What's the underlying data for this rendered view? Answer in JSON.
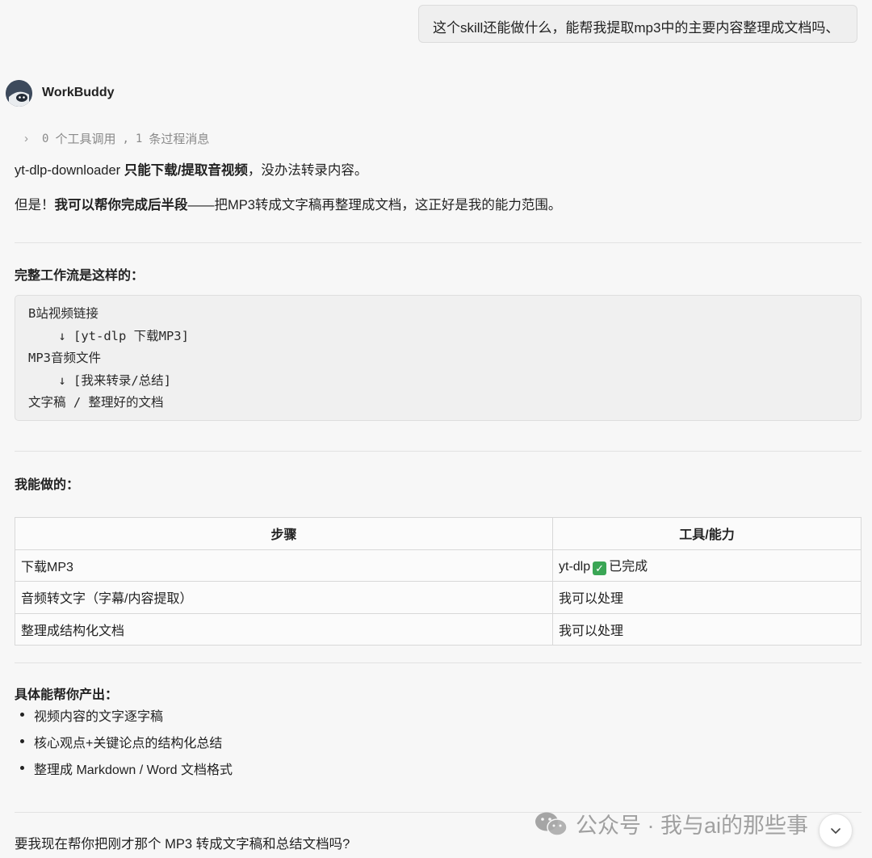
{
  "user_message": "这个skill还能做什么，能帮我提取mp3中的主要内容整理成文档吗、",
  "bot": {
    "name": "WorkBuddy"
  },
  "process": {
    "tool_count": "0",
    "tool_label": "个工具调用",
    "sep": ",",
    "msg_count": "1",
    "msg_label": "条过程消息"
  },
  "para1": {
    "text_a": "yt-dlp-downloader ",
    "bold": "只能下载/提取音视频",
    "text_b": "，没办法转录内容。"
  },
  "para2": {
    "text_a": "但是！",
    "bold": "我可以帮你完成后半段",
    "text_b": "——把MP3转成文字稿再整理成文档，这正好是我的能力范围。"
  },
  "workflow": {
    "heading": "完整工作流是这样的：",
    "lines": [
      "B站视频链接",
      "    ↓ [yt-dlp 下载MP3]",
      "MP3音频文件",
      "    ↓ [我来转录/总结]",
      "文字稿 / 整理好的文档"
    ]
  },
  "capabilities": {
    "heading": "我能做的：",
    "columns": [
      "步骤",
      "工具/能力"
    ],
    "rows": [
      {
        "step": "下载MP3",
        "tool_a": "yt-dlp",
        "tool_icon": "check-mark-icon",
        "tool_b": "已完成"
      },
      {
        "step": "音频转文字（字幕/内容提取）",
        "tool_b": "我可以处理"
      },
      {
        "step": "整理成结构化文档",
        "tool_b": "我可以处理"
      }
    ]
  },
  "outputs": {
    "heading": "具体能帮你产出：",
    "items": [
      "视频内容的文字逐字稿",
      "核心观点+关键论点的结构化总结",
      "整理成 Markdown / Word 文档格式"
    ]
  },
  "closing_question": "要我现在帮你把刚才那个 MP3 转成文字稿和总结文档吗?",
  "watermark": {
    "text": "公众号 · 我与ai的那些事"
  },
  "colors": {
    "check": "#3aa655",
    "bg": "#f7f7f7"
  }
}
